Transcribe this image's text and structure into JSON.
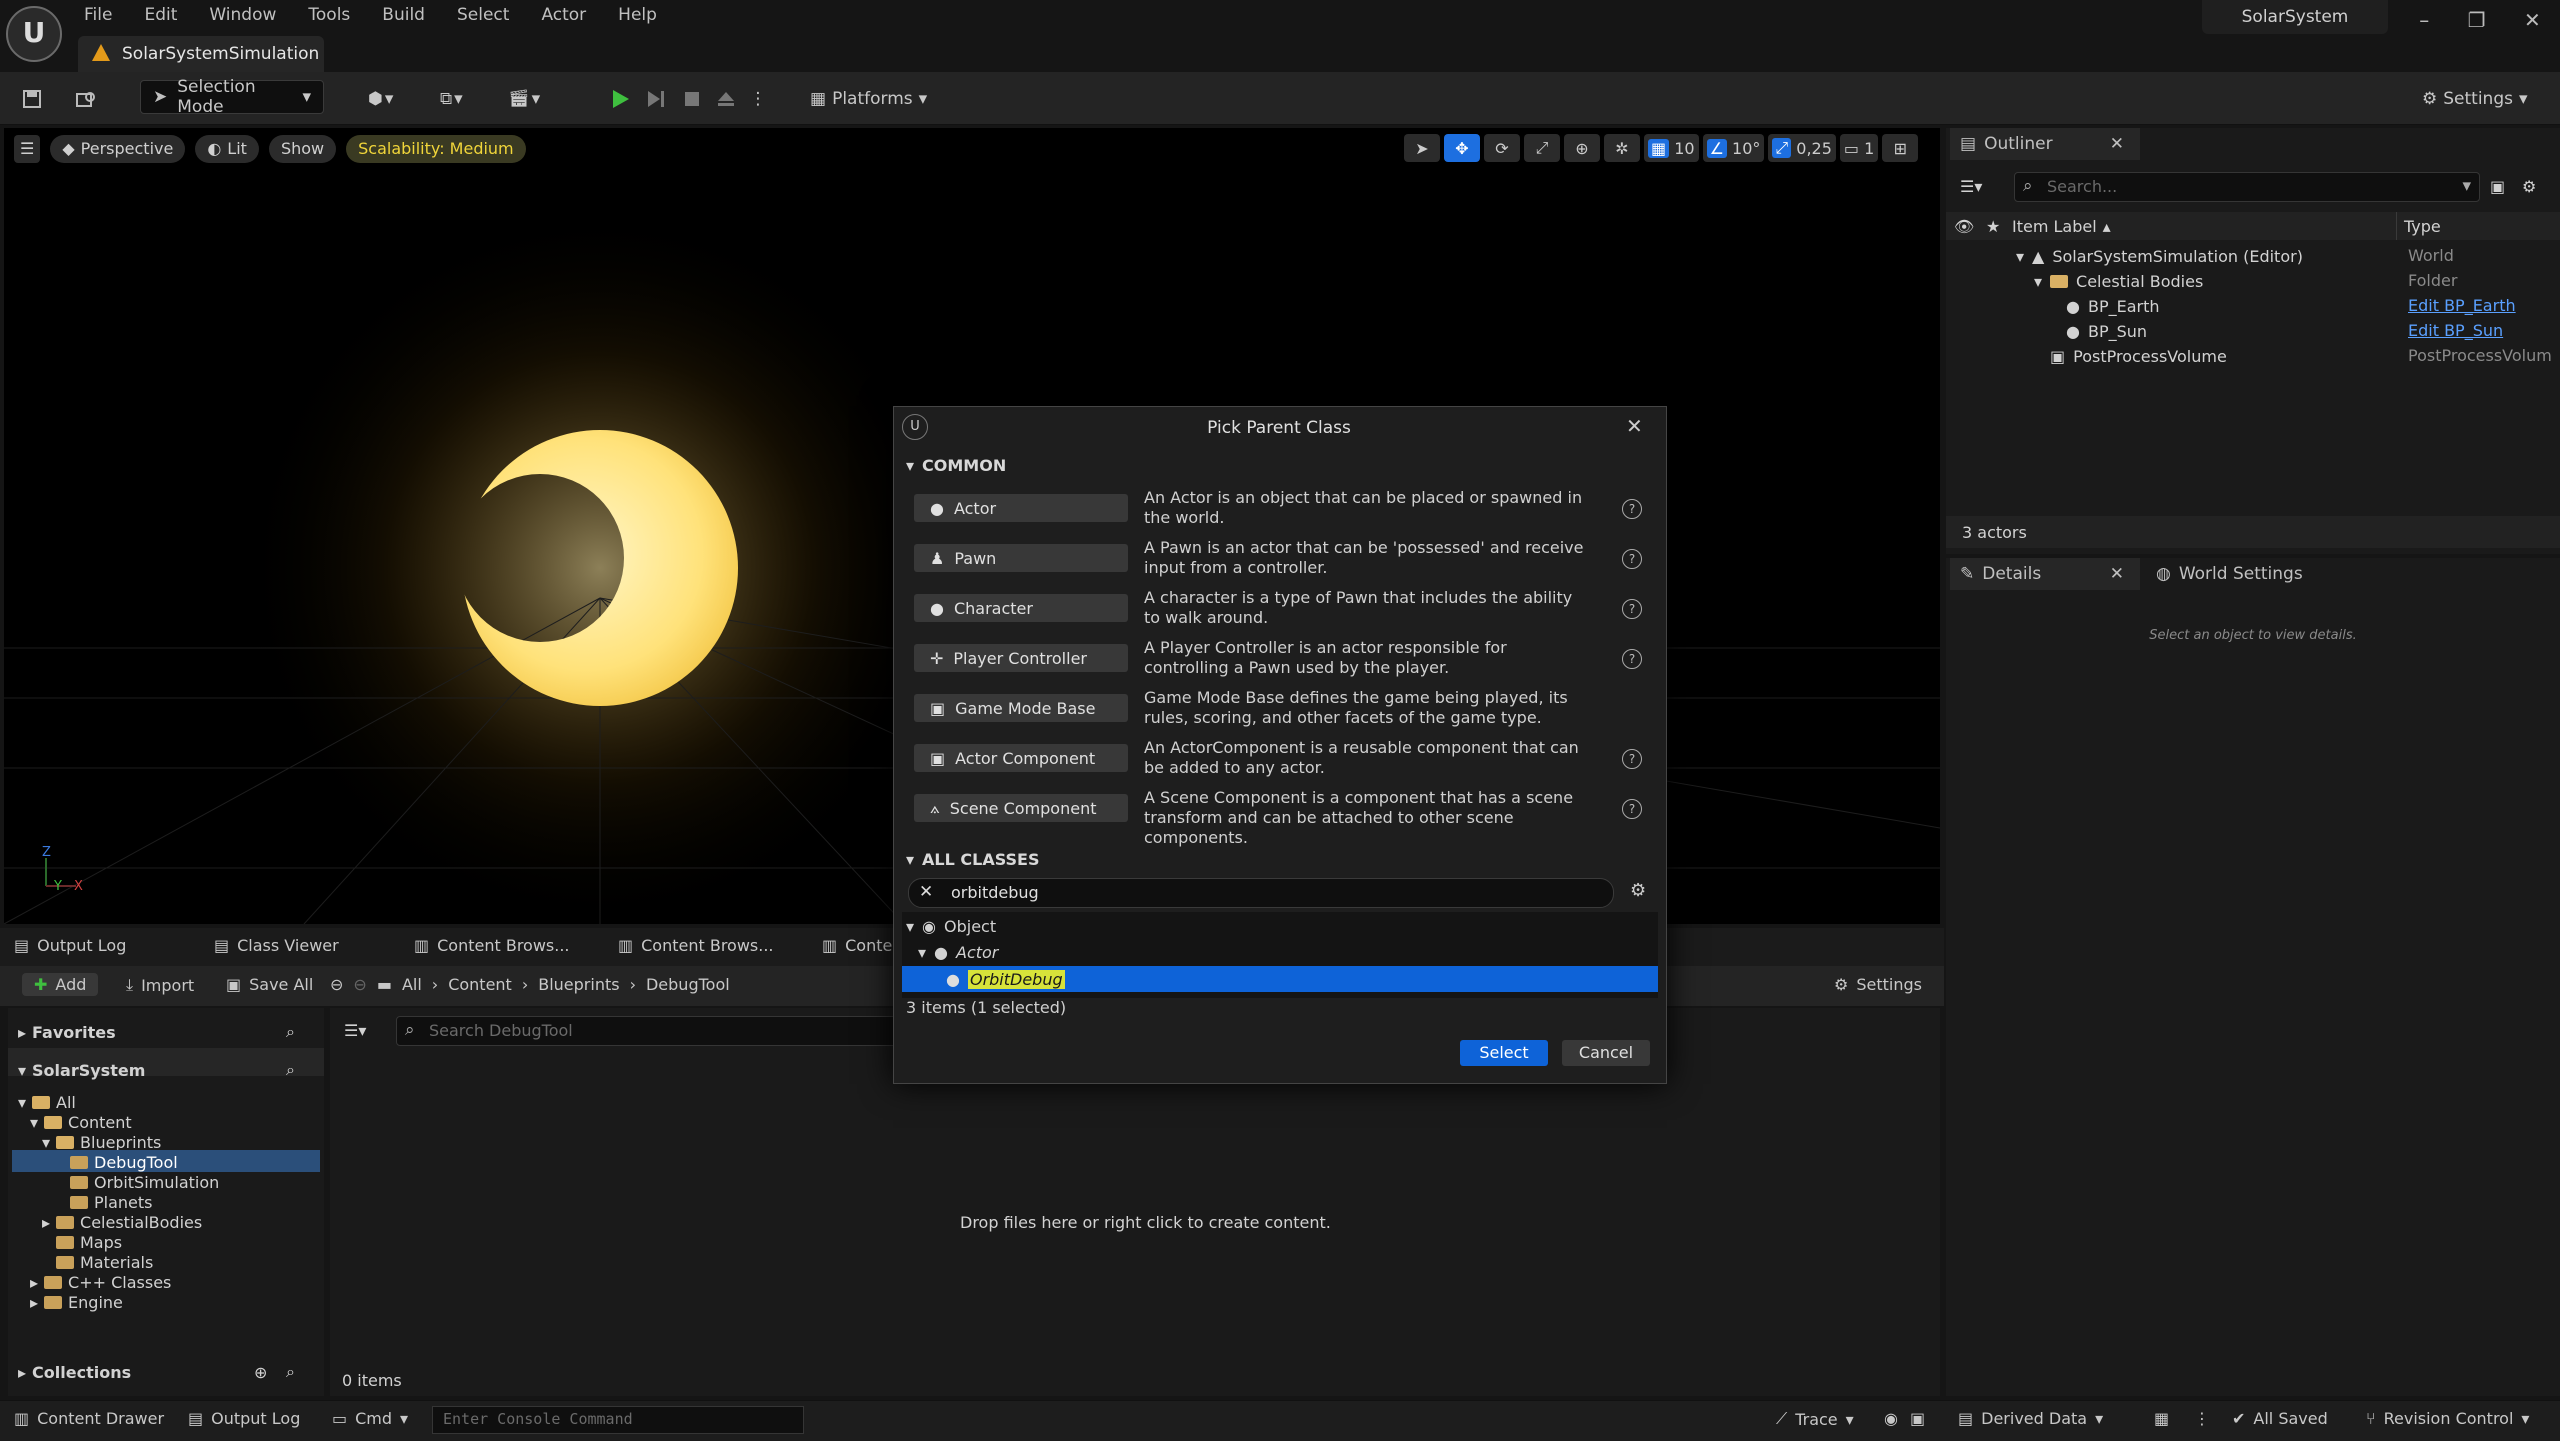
{
  "menu": [
    "File",
    "Edit",
    "Window",
    "Tools",
    "Build",
    "Select",
    "Actor",
    "Help"
  ],
  "project_name": "SolarSystem",
  "document_tab": "SolarSystemSimulation",
  "toolbar": {
    "selection_mode": "Selection Mode",
    "platforms": "Platforms",
    "settings": "Settings"
  },
  "viewport": {
    "perspective": "Perspective",
    "lit": "Lit",
    "show": "Show",
    "scalability": "Scalability: Medium",
    "grid_snap": "10",
    "rotate_snap": "10°",
    "scale_snap": "0,25",
    "camera_speed": "1"
  },
  "outliner": {
    "tab": "Outliner",
    "search_placeholder": "Search...",
    "col_label": "Item Label",
    "col_type": "Type",
    "rows": [
      {
        "label": "SolarSystemSimulation (Editor)",
        "type": "World"
      },
      {
        "label": "Celestial Bodies",
        "type": "Folder"
      },
      {
        "label": "BP_Earth",
        "type": "Edit BP_Earth"
      },
      {
        "label": "BP_Sun",
        "type": "Edit BP_Sun"
      },
      {
        "label": "PostProcessVolume",
        "type": "PostProcessVolum"
      }
    ],
    "count": "3 actors"
  },
  "details": {
    "tab": "Details",
    "world_settings": "World Settings",
    "empty_msg": "Select an object to view details."
  },
  "bottom_tabs": [
    "Output Log",
    "Class Viewer",
    "Content Brows...",
    "Content Brows...",
    "Conte"
  ],
  "content_browser": {
    "add": "Add",
    "import": "Import",
    "save_all": "Save All",
    "path": [
      "All",
      "Content",
      "Blueprints",
      "DebugTool"
    ],
    "settings": "Settings",
    "favorites": "Favorites",
    "project": "SolarSystem",
    "search_placeholder": "Search DebugTool",
    "drop_msg": "Drop files here or right click to create content.",
    "items_count": "0 items",
    "collections": "Collections",
    "tree": {
      "all": "All",
      "content": "Content",
      "blueprints": "Blueprints",
      "debugtool": "DebugTool",
      "orbitsim": "OrbitSimulation",
      "planets": "Planets",
      "celestial": "CelestialBodies",
      "maps": "Maps",
      "materials": "Materials",
      "cpp": "C++ Classes",
      "engine": "Engine"
    }
  },
  "dialog": {
    "title": "Pick Parent Class",
    "common": "COMMON",
    "classes": [
      {
        "name": "Actor",
        "desc": "An Actor is an object that can be placed or spawned in the world."
      },
      {
        "name": "Pawn",
        "desc": "A Pawn is an actor that can be 'possessed' and receive input from a controller."
      },
      {
        "name": "Character",
        "desc": "A character is a type of Pawn that includes the ability to walk around."
      },
      {
        "name": "Player Controller",
        "desc": "A Player Controller is an actor responsible for controlling a Pawn used by the player."
      },
      {
        "name": "Game Mode Base",
        "desc": "Game Mode Base defines the game being played, its rules, scoring, and other facets of the game type."
      },
      {
        "name": "Actor Component",
        "desc": "An ActorComponent is a reusable component that can be added to any actor."
      },
      {
        "name": "Scene Component",
        "desc": "A Scene Component is a component that has a scene transform and can be attached to other scene components."
      }
    ],
    "all_classes": "ALL CLASSES",
    "search_value": "orbitdebug",
    "tree": [
      "Object",
      "Actor",
      "OrbitDebug"
    ],
    "count": "3 items (1 selected)",
    "select": "Select",
    "cancel": "Cancel"
  },
  "statusbar": {
    "content_drawer": "Content Drawer",
    "output_log": "Output Log",
    "cmd": "Cmd",
    "console_placeholder": "Enter Console Command",
    "trace": "Trace",
    "derived_data": "Derived Data",
    "all_saved": "All Saved",
    "revision_control": "Revision Control"
  }
}
